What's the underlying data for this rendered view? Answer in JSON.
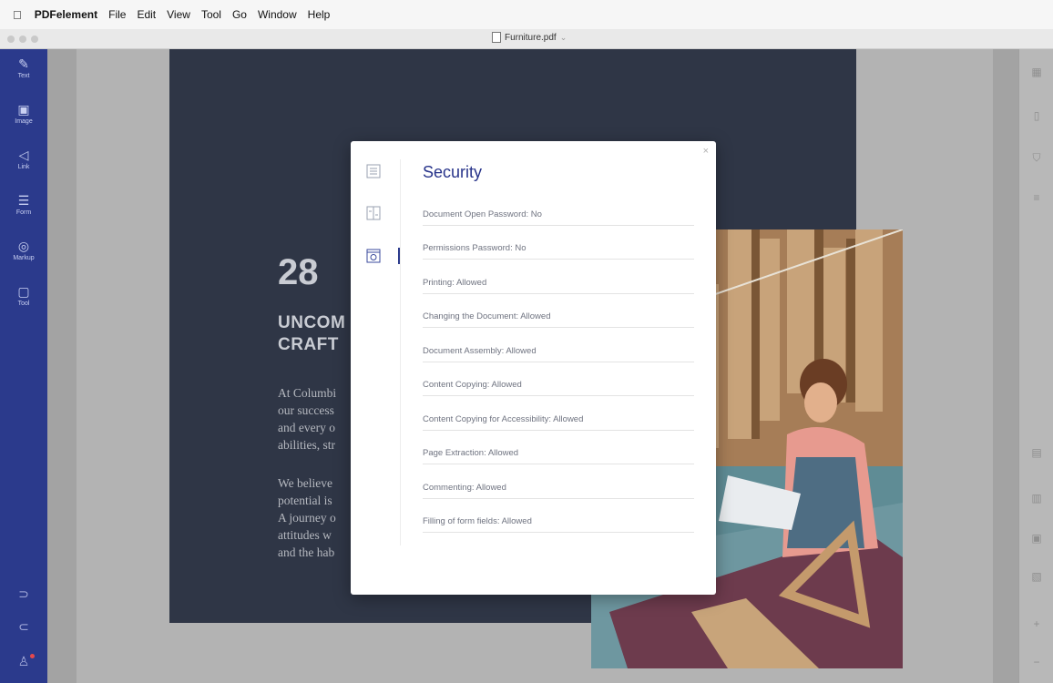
{
  "menubar": {
    "app_name": "PDFelement",
    "items": [
      "File",
      "Edit",
      "View",
      "Tool",
      "Go",
      "Window",
      "Help"
    ]
  },
  "titlebar": {
    "document_name": "Furniture.pdf"
  },
  "left_toolbar": {
    "tools": [
      {
        "label": "Text",
        "icon": "pencil-icon",
        "glyph": "✎"
      },
      {
        "label": "Image",
        "icon": "image-icon",
        "glyph": "▣"
      },
      {
        "label": "Link",
        "icon": "link-icon",
        "glyph": "◁"
      },
      {
        "label": "Form",
        "icon": "form-icon",
        "glyph": "☰"
      },
      {
        "label": "Markup",
        "icon": "markup-icon",
        "glyph": "◎"
      },
      {
        "label": "Tool",
        "icon": "toolbox-icon",
        "glyph": "▢"
      }
    ]
  },
  "page": {
    "number": "28",
    "heading_line1": "UNCOM",
    "heading_line2": "CRAFT",
    "para1": [
      "At Columbi",
      "our success",
      "and every o",
      "abilities, str"
    ],
    "para2": [
      "We believe",
      "potential is",
      "A journey o",
      "attitudes w",
      "and the hab"
    ]
  },
  "security_dialog": {
    "title": "Security",
    "close_glyph": "×",
    "rows": [
      "Document Open Password: No",
      "Permissions Password: No",
      "Printing: Allowed",
      "Changing the Document: Allowed",
      "Document Assembly: Allowed",
      "Content Copying: Allowed",
      "Content Copying for Accessibility: Allowed",
      "Page Extraction: Allowed",
      "Commenting: Allowed",
      "Filling of form fields: Allowed"
    ]
  },
  "colors": {
    "sidebar": "#2b3a8c",
    "accent": "#27338a",
    "page_background": "#2f3646"
  }
}
